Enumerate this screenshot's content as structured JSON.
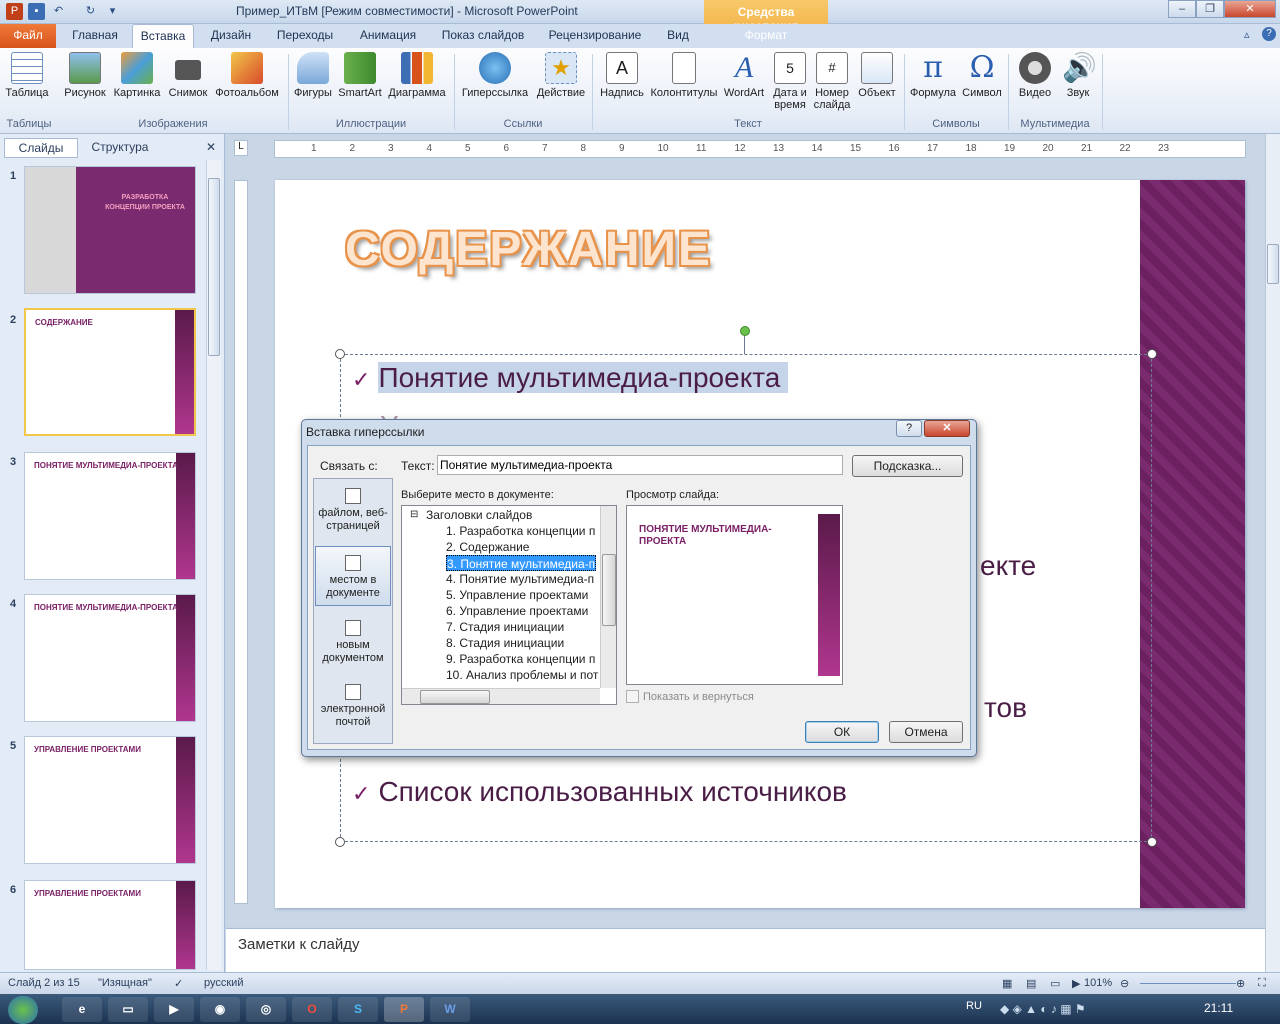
{
  "window": {
    "title": "Пример_ИТвМ [Режим совместимости] - Microsoft PowerPoint",
    "context_tab_group": "Средства рисования",
    "context_tab": "Формат"
  },
  "tabs": [
    "Файл",
    "Главная",
    "Вставка",
    "Дизайн",
    "Переходы",
    "Анимация",
    "Показ слайдов",
    "Рецензирование",
    "Вид"
  ],
  "ribbon": {
    "buttons": [
      "Таблица",
      "Рисунок",
      "Картинка",
      "Снимок",
      "Фотоальбом",
      "Фигуры",
      "SmartArt",
      "Диаграмма",
      "Гиперссылка",
      "Действие",
      "Надпись",
      "Колонтитулы",
      "WordArt",
      "Дата и",
      "время",
      "Номер",
      "слайда",
      "Объект",
      "Формула",
      "Символ",
      "Видео",
      "Звук"
    ],
    "groups": [
      "Таблицы",
      "Изображения",
      "Иллюстрации",
      "Ссылки",
      "Текст",
      "Символы",
      "Мультимедиа"
    ]
  },
  "left_panel": {
    "tabs": [
      "Слайды",
      "Структура"
    ],
    "slide_numbers": [
      "1",
      "2",
      "3",
      "4",
      "5",
      "6"
    ],
    "thumbs": {
      "t1_title": "РАЗРАБОТКА КОНЦЕПЦИИ ПРОЕКТА",
      "t2_title": "СОДЕРЖАНИЕ",
      "t3_title": "ПОНЯТИЕ МУЛЬТИМЕДИА-ПРОЕКТА",
      "t4_title": "ПОНЯТИЕ МУЛЬТИМЕДИА-ПРОЕКТА",
      "t5_title": "УПРАВЛЕНИЕ ПРОЕКТАМИ",
      "t6_title": "УПРАВЛЕНИЕ ПРОЕКТАМИ"
    }
  },
  "ruler": [
    "1",
    "2",
    "3",
    "4",
    "5",
    "6",
    "7",
    "8",
    "9",
    "10",
    "11",
    "12",
    "13",
    "14",
    "15",
    "16",
    "17",
    "18",
    "19",
    "20",
    "21",
    "22",
    "23"
  ],
  "slide": {
    "title": "СОДЕРЖАНИЕ",
    "bullets": [
      "Понятие мультимедиа-проекта",
      "Управление проектами",
      "екте",
      "тов",
      "Список использованных источников"
    ]
  },
  "notes_placeholder": "Заметки к слайду",
  "status": {
    "slide": "Слайд 2 из 15",
    "theme": "\"Изящная\"",
    "language": "русский",
    "zoom": "101%"
  },
  "taskbar": {
    "lang": "RU",
    "time": "21:11"
  },
  "dialog": {
    "title": "Вставка гиперссылки",
    "link_to_label": "Связать с:",
    "text_label": "Текст:",
    "text_value": "Понятие мультимедиа-проекта",
    "hint_button": "Подсказка...",
    "place_label": "Выберите место в документе:",
    "preview_label": "Просмотр слайда:",
    "link_options": [
      "файлом, веб-страницей",
      "местом в документе",
      "новым документом",
      "электронной почтой"
    ],
    "tree_root": "Заголовки слайдов",
    "tree_items": [
      "1. Разработка  концепции п",
      "2. Содержание",
      "3. Понятие мультимедиа-п",
      "4. Понятие мультимедиа-п",
      "5. Управление проектами",
      "6. Управление проектами",
      "7. Стадия инициации",
      "8. Стадия инициации",
      "9. Разработка концепции п",
      "10. Анализ проблемы и пот"
    ],
    "selected_index": 2,
    "preview_title": "ПОНЯТИЕ МУЛЬТИМЕДИА-ПРОЕКТА",
    "show_return": "Показать и вернуться",
    "ok": "ОК",
    "cancel": "Отмена"
  }
}
